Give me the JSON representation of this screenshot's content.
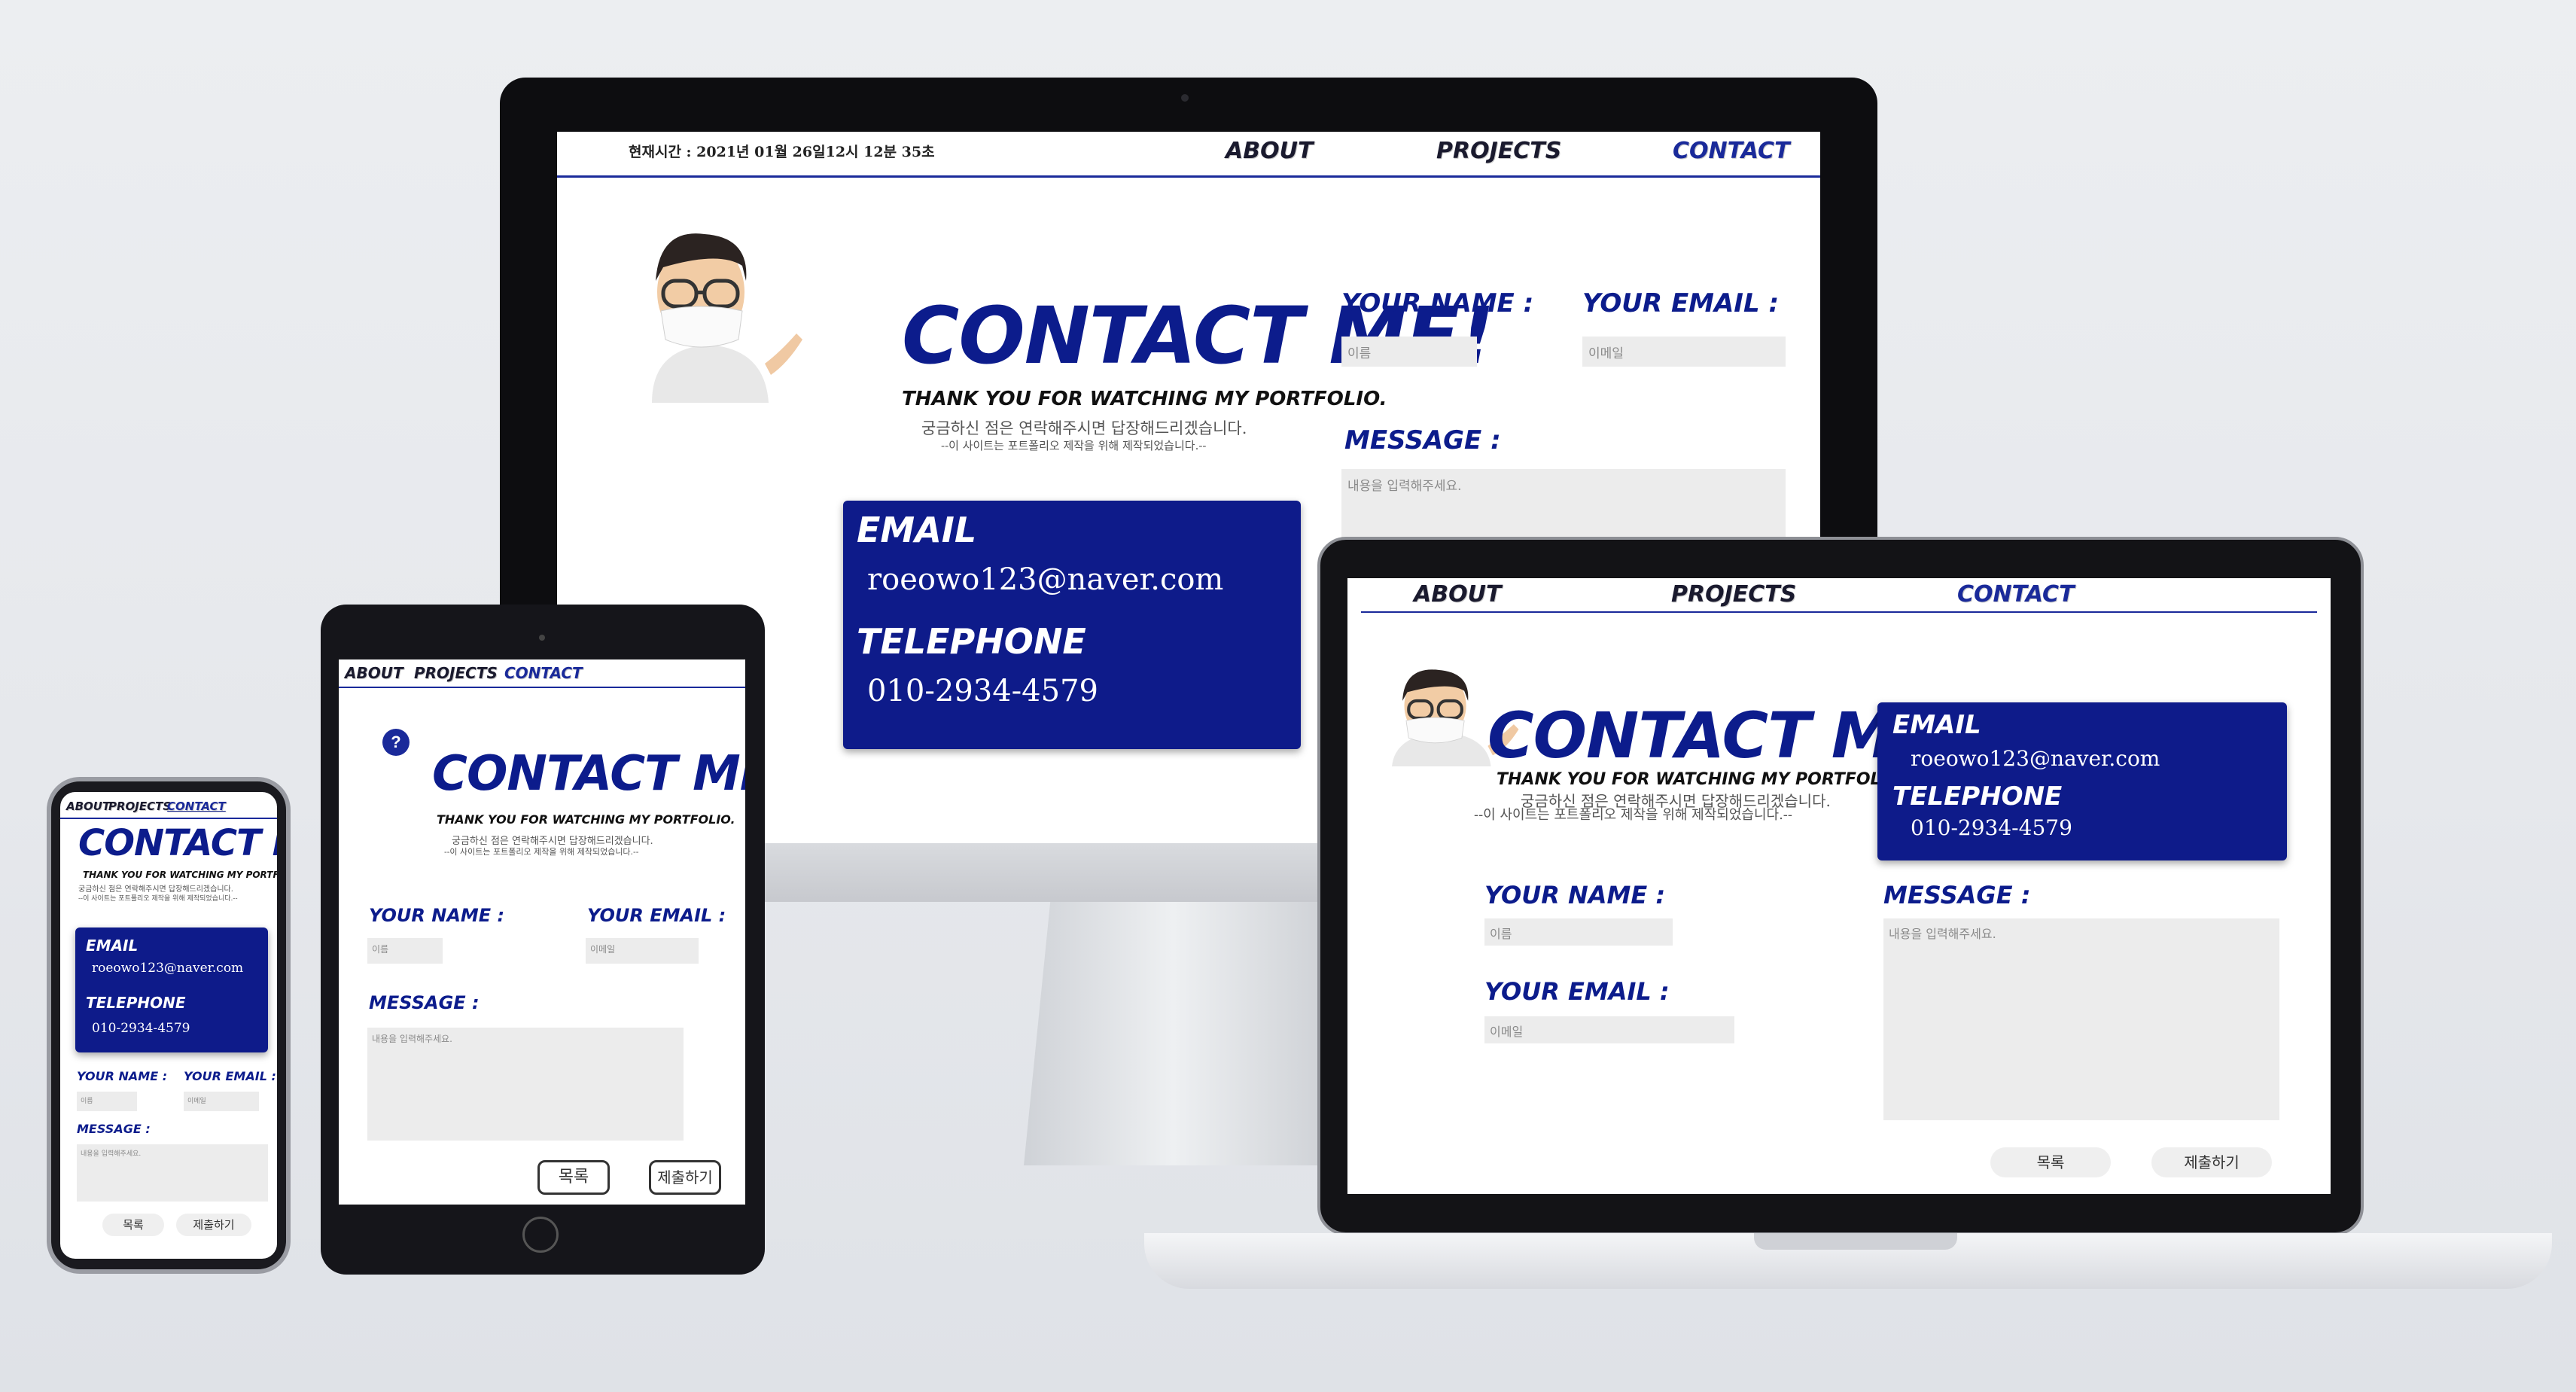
{
  "nav": {
    "about": "ABOUT",
    "projects": "PROJECTS",
    "contact": "CONTACT"
  },
  "clock": "현재시간 : 2021년 01월 26일12시 12분 35초",
  "contact": {
    "heading": "CONTACT ME!",
    "subheading": "THANK YOU FOR WATCHING MY PORTFOLIO.",
    "line1": "궁금하신 점은 연락해주시면 답장해드리겠습니다.",
    "line2": "--이 사이트는 포트폴리오 제작을 위해 제작되었습니다.--",
    "email_label": "EMAIL",
    "email_value": "roeowo123@naver.com",
    "tel_label": "TELEPHONE",
    "tel_value": "010-2934-4579"
  },
  "form": {
    "name_label": "YOUR NAME :",
    "email_label": "YOUR EMAIL :",
    "message_label": "MESSAGE :",
    "name_placeholder": "이름",
    "email_placeholder": "이메일",
    "message_placeholder": "내용을 입력해주세요.",
    "list_button": "목록",
    "submit_button": "제출하기"
  },
  "help_icon": "?",
  "colors": {
    "accent": "#0c1c8c",
    "card": "#0e1b8a",
    "field": "#ececec"
  }
}
